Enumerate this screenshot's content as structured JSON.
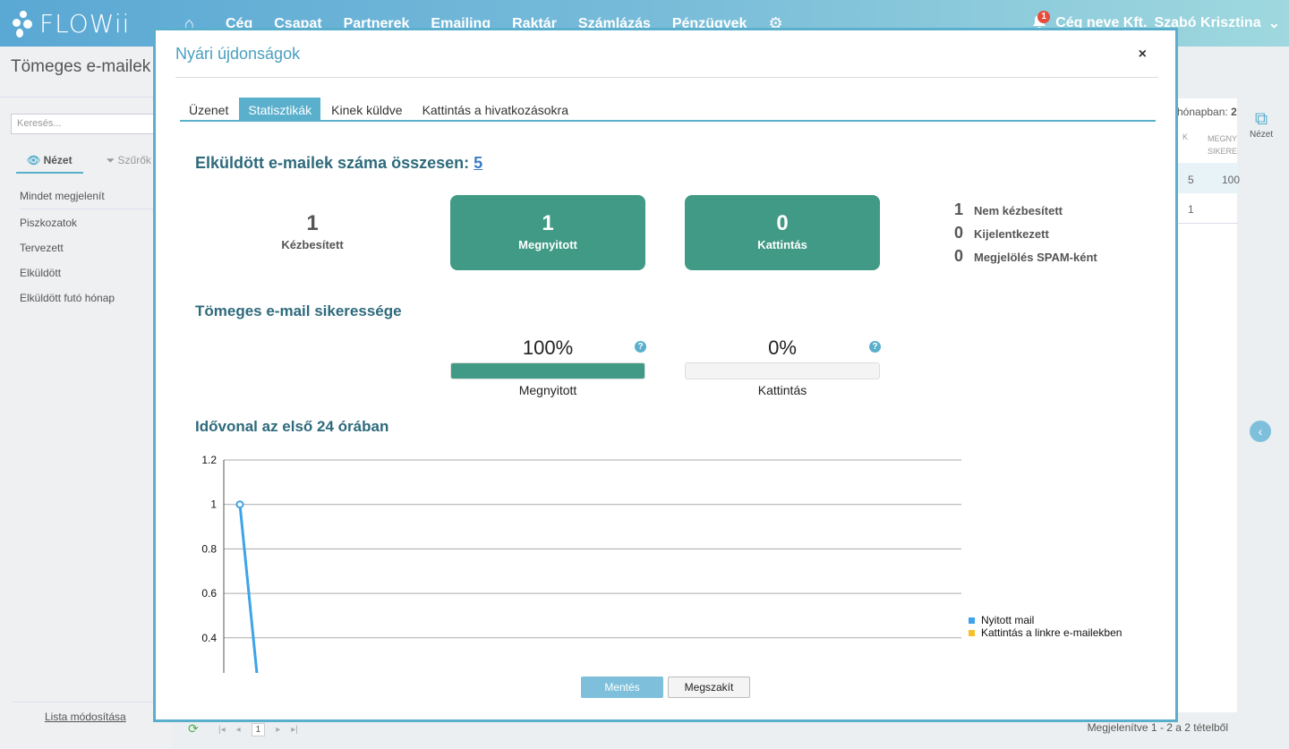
{
  "header": {
    "logo": "FLOWii",
    "nav": [
      "Cég",
      "Csapat",
      "Partnerek",
      "Emailing",
      "Raktár",
      "Számlázás",
      "Pénzügyek"
    ],
    "notification_count": "1",
    "company": "Cég neve Kft.",
    "user": "Szabó Krisztina"
  },
  "left": {
    "page_title": "Tömeges e-mailek",
    "search_placeholder": "Keresés...",
    "view_tab": "Nézet",
    "filter_tab": "Szűrők",
    "menu": [
      "Mindet megjelenít",
      "Piszkozatok",
      "Tervezett",
      "Elküldött",
      "Elküldött futó hónap"
    ],
    "list_edit": "Lista módosítása"
  },
  "background": {
    "info_label": "hónapban:",
    "info_value": "2",
    "col_a": "K",
    "col_b_line1": "MEGNY",
    "col_b_line2": "SIKERE",
    "row1_a": "5",
    "row1_b": "100",
    "row2_a": "1",
    "view_btn": "Nézet",
    "pager_page": "1",
    "footer_meta": "Megjelenítve 1 - 2 a 2 tételből"
  },
  "modal": {
    "title": "Nyári újdonságok",
    "close": "×",
    "tabs": [
      "Üzenet",
      "Statisztikák",
      "Kinek küldve",
      "Kattintás a hivatkozásokra"
    ],
    "active_tab": 1,
    "sent_total_label": "Elküldött e-mailek száma összesen:",
    "sent_total_value": "5",
    "stats": {
      "delivered": {
        "value": "1",
        "label": "Kézbesített"
      },
      "opened": {
        "value": "1",
        "label": "Megnyitott"
      },
      "clicks": {
        "value": "0",
        "label": "Kattintás"
      }
    },
    "side_stats": [
      {
        "value": "1",
        "label": "Nem kézbesített"
      },
      {
        "value": "0",
        "label": "Kijelentkezett"
      },
      {
        "value": "0",
        "label": "Megjelölés SPAM-ként"
      }
    ],
    "success_title": "Tömeges e-mail sikeressége",
    "success": {
      "opened_pct": "100%",
      "opened_fill": 1.0,
      "opened_label": "Megnyitott",
      "click_pct": "0%",
      "click_fill": 0.0,
      "click_label": "Kattintás",
      "help": "?"
    },
    "timeline_title": "Idővonal az első 24 órában",
    "save_button": "Mentés",
    "cancel_button": "Megszakít"
  },
  "colors": {
    "accent": "#5ab0cc",
    "green": "#419a85",
    "series_open": "#3ea3e8",
    "series_click": "#f6c02b"
  },
  "chart_data": {
    "type": "line",
    "title": "",
    "xlabel": "",
    "ylabel": "",
    "yticks": [
      "1.2",
      "1",
      "0.8",
      "0.6",
      "0.4"
    ],
    "ylim": [
      0.4,
      1.2
    ],
    "grid": true,
    "legend": "right",
    "series": [
      {
        "name": "Nyitott mail",
        "color": "#3ea3e8",
        "x": [
          0,
          1
        ],
        "values": [
          1,
          0
        ]
      },
      {
        "name": "Kattintás a linkre e-mailekben",
        "color": "#f6c02b",
        "x": [],
        "values": []
      }
    ]
  }
}
